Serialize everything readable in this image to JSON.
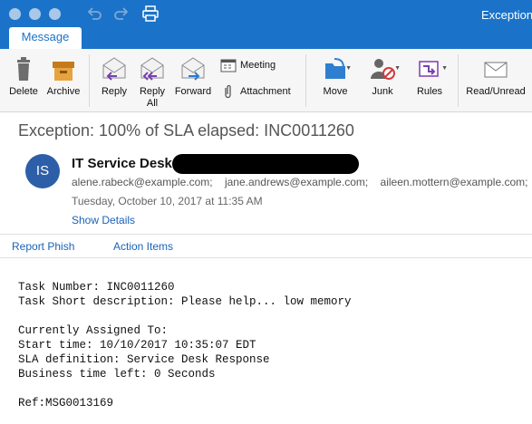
{
  "window": {
    "title": "Exception"
  },
  "titlebar_icons": [
    "undo-icon",
    "redo-icon",
    "print-icon"
  ],
  "ribbon": {
    "tab": "Message",
    "buttons": {
      "delete": "Delete",
      "archive": "Archive",
      "reply": "Reply",
      "reply_all": "Reply All",
      "forward": "Forward",
      "meeting": "Meeting",
      "attachment": "Attachment",
      "move": "Move",
      "junk": "Junk",
      "rules": "Rules",
      "read_unread": "Read/Unread"
    }
  },
  "message": {
    "subject": "Exception: 100% of SLA elapsed: INC0011260",
    "avatar_initials": "IS",
    "sender": "IT Service Desk",
    "recipients": [
      "alene.rabeck@example.com;",
      "jane.andrews@example.com;",
      "aileen.mottern@example.com;"
    ],
    "date": "Tuesday, October 10, 2017 at 11:35 AM",
    "show_details": "Show Details"
  },
  "addins": {
    "report_phish": "Report Phish",
    "action_items": "Action Items"
  },
  "body": {
    "lines": [
      "Task Number: INC0011260",
      "Task Short description: Please help... low memory",
      "",
      "Currently Assigned To:",
      "Start time: 10/10/2017 10:35:07 EDT",
      "SLA definition: Service Desk Response",
      "Business time left: 0 Seconds",
      "",
      "Ref:MSG0013169"
    ]
  },
  "colors": {
    "titlebar": "#1a73c9",
    "link": "#1a63b8",
    "avatar": "#2d5ea8"
  }
}
